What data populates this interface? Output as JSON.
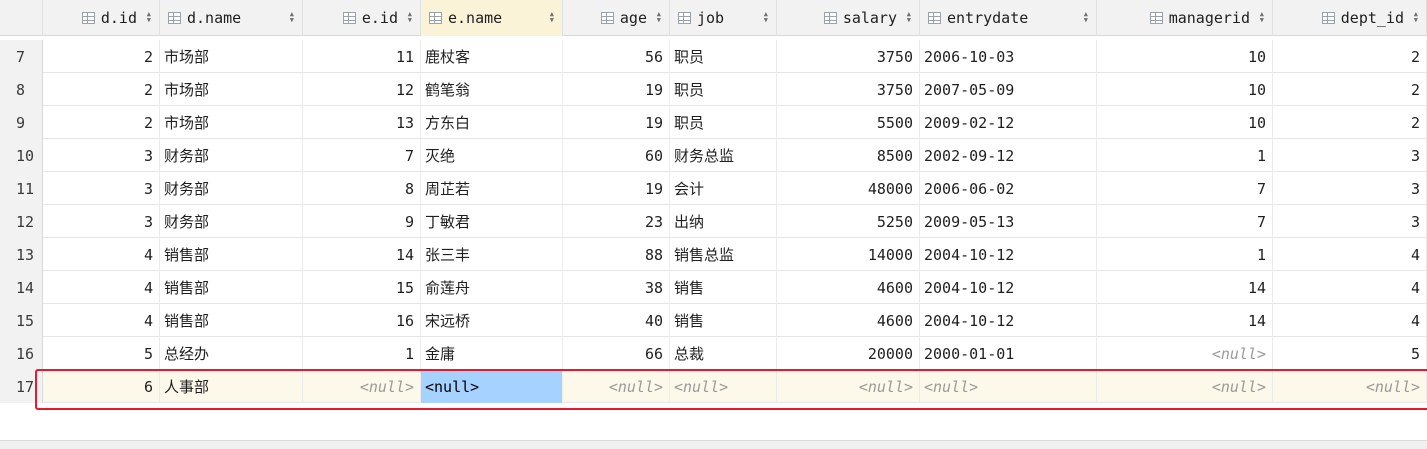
{
  "columns": [
    {
      "label": "d.id",
      "align": "right"
    },
    {
      "label": "d.name",
      "align": "left"
    },
    {
      "label": "e.id",
      "align": "right"
    },
    {
      "label": "e.name",
      "align": "left"
    },
    {
      "label": "age",
      "align": "right"
    },
    {
      "label": "job",
      "align": "left"
    },
    {
      "label": "salary",
      "align": "right"
    },
    {
      "label": "entrydate",
      "align": "left"
    },
    {
      "label": "managerid",
      "align": "right"
    },
    {
      "label": "dept_id",
      "align": "right"
    }
  ],
  "null_text": "<null>",
  "rows": [
    {
      "num": "7",
      "cells": [
        "2",
        "市场部",
        "11",
        "鹿杖客",
        "56",
        "职员",
        "3750",
        "2006-10-03",
        "10",
        "2"
      ]
    },
    {
      "num": "8",
      "cells": [
        "2",
        "市场部",
        "12",
        "鹤笔翁",
        "19",
        "职员",
        "3750",
        "2007-05-09",
        "10",
        "2"
      ]
    },
    {
      "num": "9",
      "cells": [
        "2",
        "市场部",
        "13",
        "方东白",
        "19",
        "职员",
        "5500",
        "2009-02-12",
        "10",
        "2"
      ]
    },
    {
      "num": "10",
      "cells": [
        "3",
        "财务部",
        "7",
        "灭绝",
        "60",
        "财务总监",
        "8500",
        "2002-09-12",
        "1",
        "3"
      ]
    },
    {
      "num": "11",
      "cells": [
        "3",
        "财务部",
        "8",
        "周芷若",
        "19",
        "会计",
        "48000",
        "2006-06-02",
        "7",
        "3"
      ]
    },
    {
      "num": "12",
      "cells": [
        "3",
        "财务部",
        "9",
        "丁敏君",
        "23",
        "出纳",
        "5250",
        "2009-05-13",
        "7",
        "3"
      ]
    },
    {
      "num": "13",
      "cells": [
        "4",
        "销售部",
        "14",
        "张三丰",
        "88",
        "销售总监",
        "14000",
        "2004-10-12",
        "1",
        "4"
      ]
    },
    {
      "num": "14",
      "cells": [
        "4",
        "销售部",
        "15",
        "俞莲舟",
        "38",
        "销售",
        "4600",
        "2004-10-12",
        "14",
        "4"
      ]
    },
    {
      "num": "15",
      "cells": [
        "4",
        "销售部",
        "16",
        "宋远桥",
        "40",
        "销售",
        "4600",
        "2004-10-12",
        "14",
        "4"
      ]
    },
    {
      "num": "16",
      "cells": [
        "5",
        "总经办",
        "1",
        "金庸",
        "66",
        "总裁",
        "20000",
        "2000-01-01",
        null,
        "5"
      ]
    },
    {
      "num": "17",
      "cells": [
        "6",
        "人事部",
        null,
        null,
        null,
        null,
        null,
        null,
        null,
        null
      ]
    }
  ],
  "selected_cell": {
    "row": 10,
    "col": 3
  },
  "current_row": 10,
  "colors": {
    "highlight_border": "#e8192c",
    "selection": "#a6d2ff",
    "current_row_bg": "#fcf8ea",
    "header_bg": "#f2f2f2",
    "null_text": "#9a9a9a"
  },
  "icons": {
    "column_header": "table-column-icon",
    "sort": "sort-arrows-icon"
  }
}
